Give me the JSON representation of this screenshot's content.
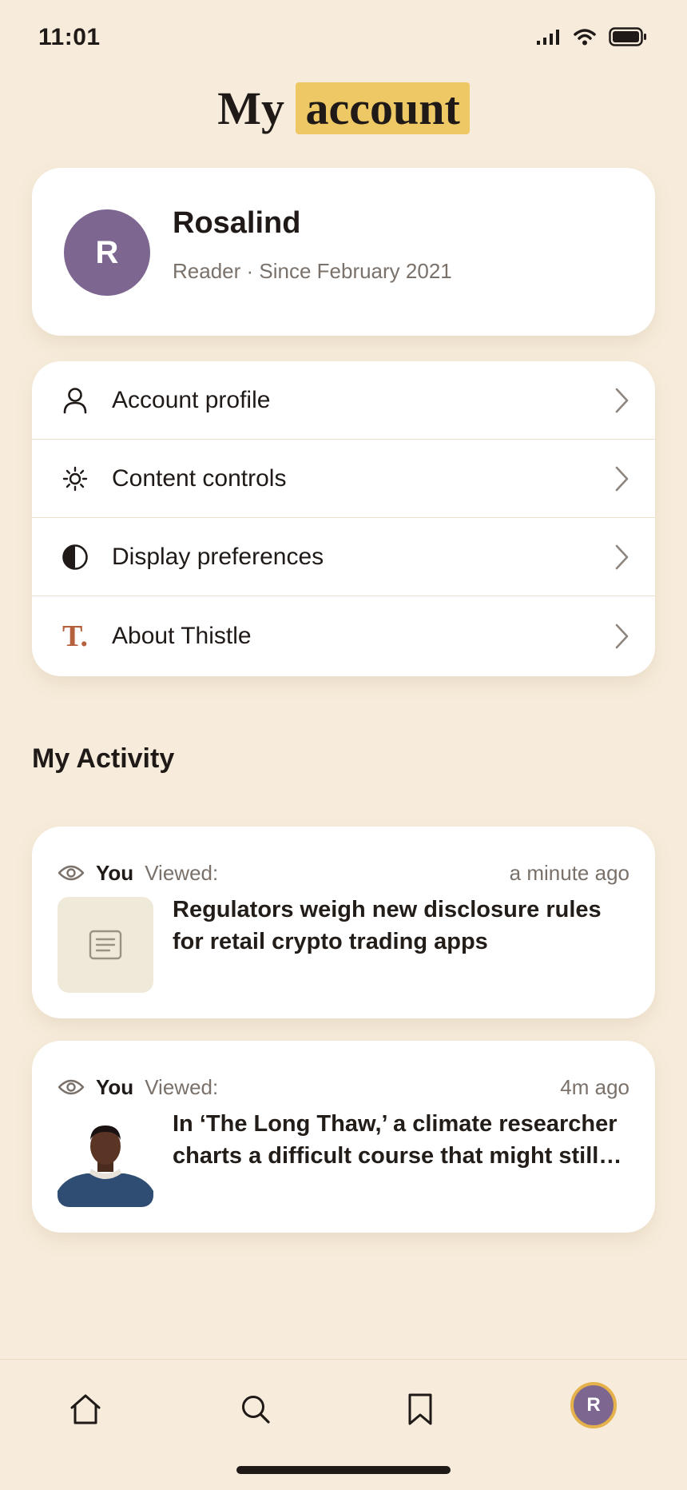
{
  "status_bar": {
    "time": "11:01"
  },
  "page": {
    "title_plain": "My",
    "title_highlight": "account"
  },
  "profile": {
    "initial": "R",
    "name": "Rosalind",
    "subtitle": "Reader · Since February 2021"
  },
  "menu": {
    "items": [
      {
        "label": "Account profile",
        "icon": "person-icon"
      },
      {
        "label": "Content controls",
        "icon": "sun-icon"
      },
      {
        "label": "Display preferences",
        "icon": "contrast-icon"
      },
      {
        "label": "About Thistle",
        "icon": "thistle-logo-icon",
        "logo_text": "T."
      }
    ]
  },
  "activity": {
    "section_title": "My Activity",
    "items": [
      {
        "actor": "You",
        "action": "Viewed:",
        "time": "a minute ago",
        "title": "Regulators weigh new disclosure rules for retail crypto trading apps",
        "thumbnail": "article-placeholder-icon"
      },
      {
        "actor": "You",
        "action": "Viewed:",
        "time": "4m ago",
        "title": "In ‘The Long Thaw,’ a climate researcher charts a difficult course that might still lead somewhere",
        "thumbnail": "portrait-photo"
      }
    ]
  },
  "bottom_nav": {
    "items": [
      "home-icon",
      "search-icon",
      "bookmark-icon",
      "profile-avatar"
    ],
    "avatar_initial": "R"
  },
  "colors": {
    "background": "#f7ecdb",
    "title_highlight": "#efc866",
    "avatar": "#7d6690",
    "avatar_ring": "#e4b14a",
    "brand": "#b6613d"
  }
}
